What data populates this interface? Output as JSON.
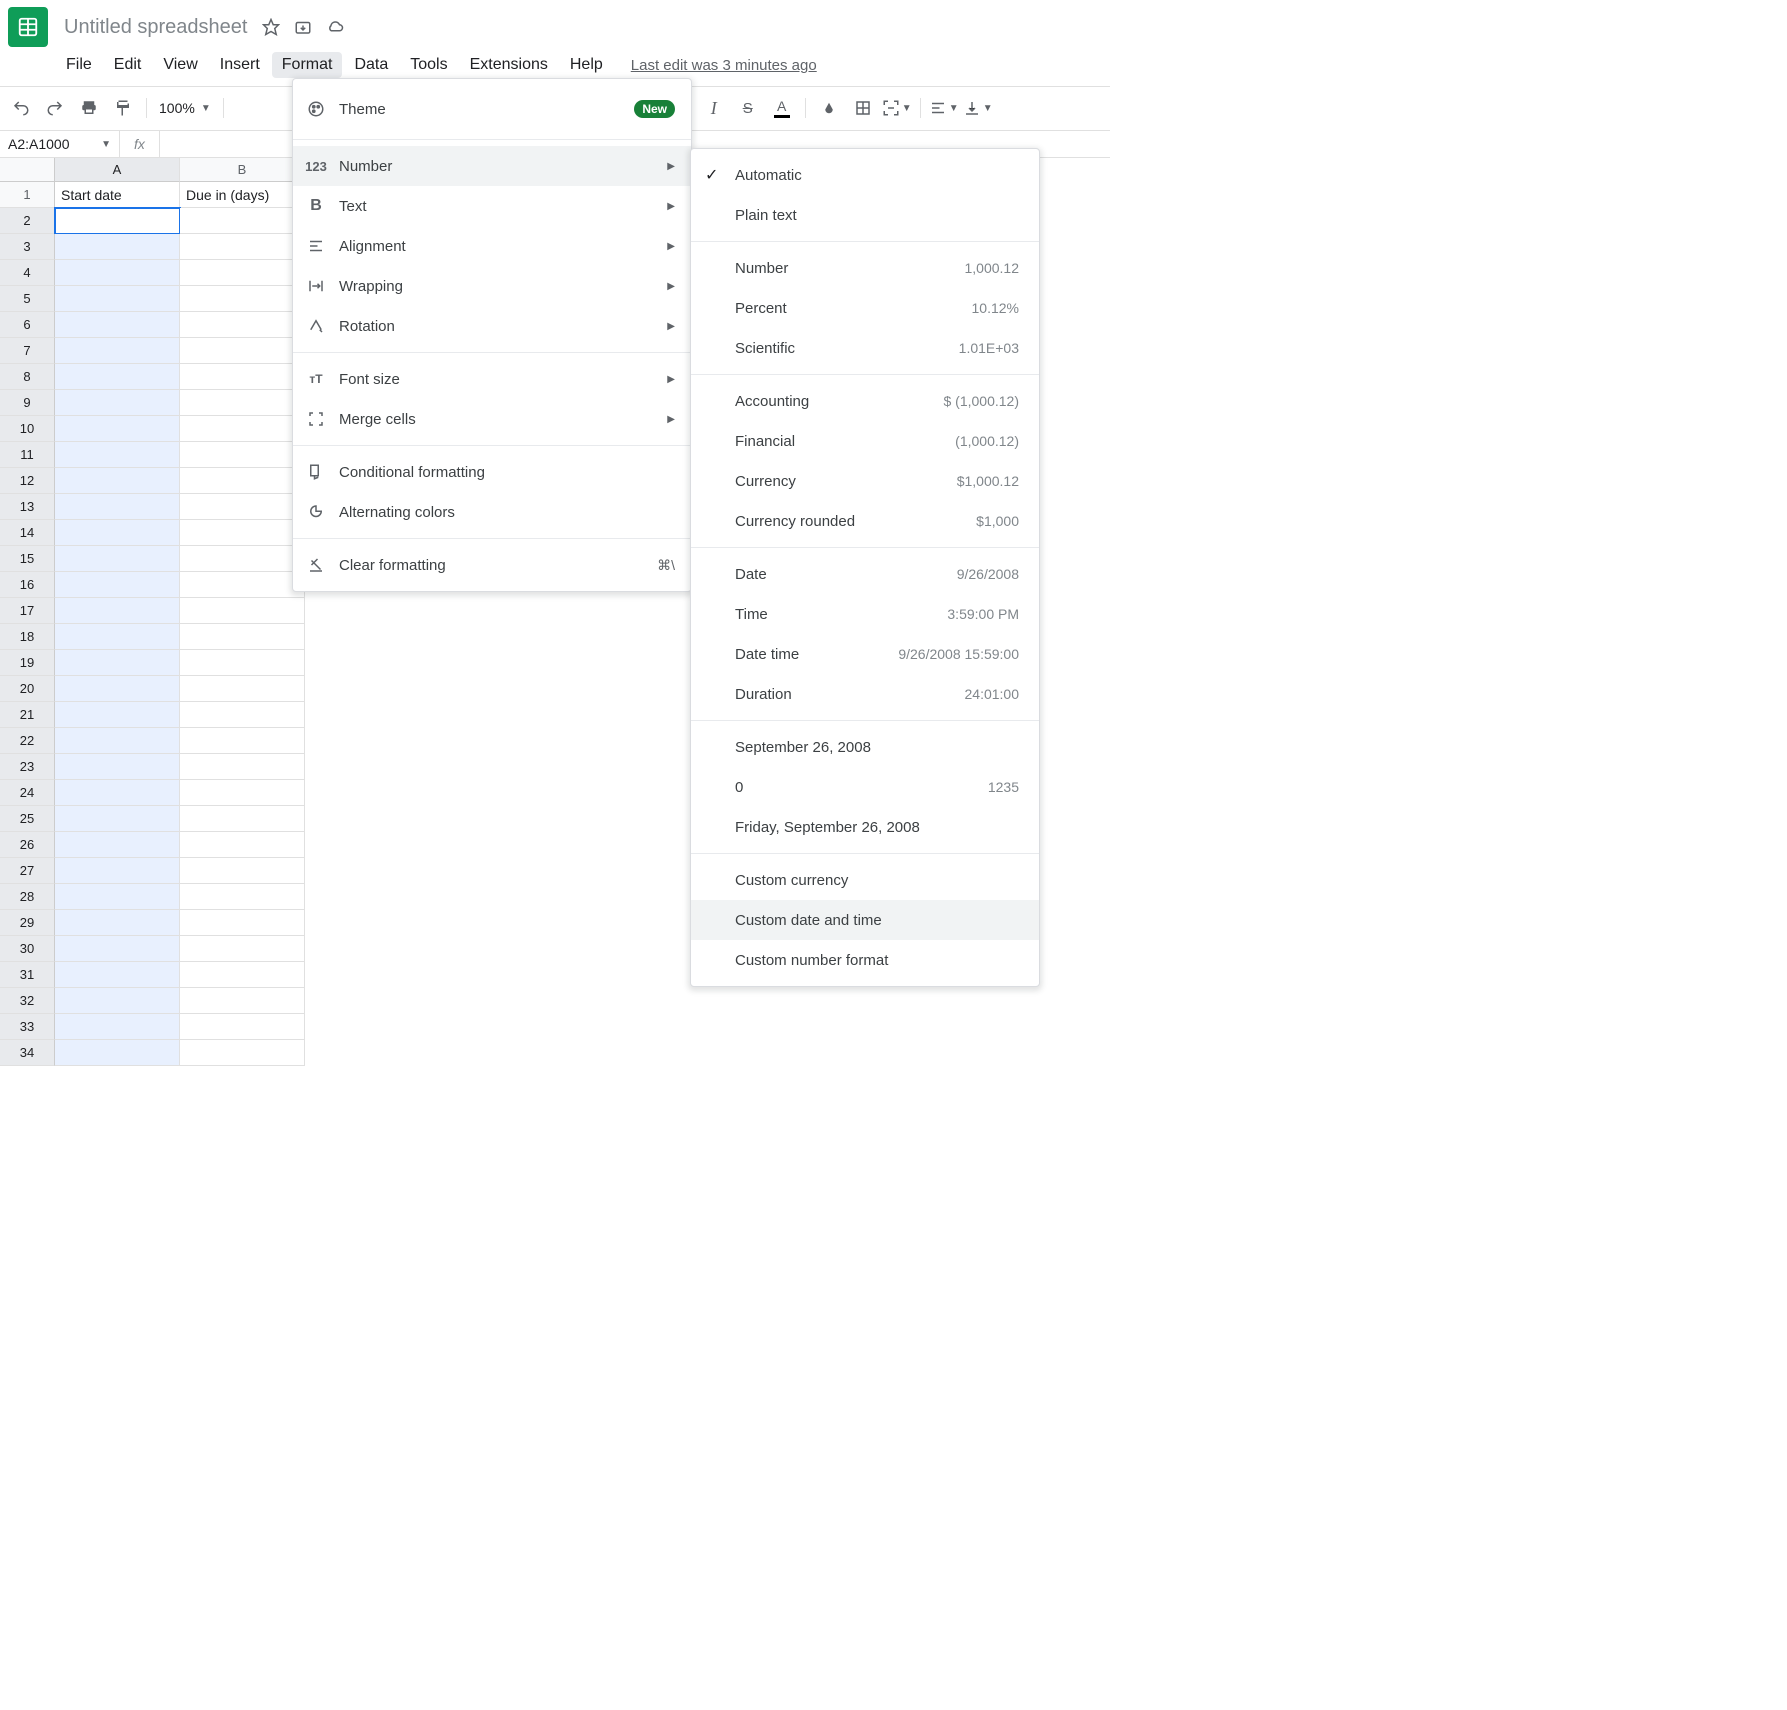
{
  "title": "Untitled spreadsheet",
  "menus": {
    "file": "File",
    "edit": "Edit",
    "view": "View",
    "insert": "Insert",
    "format": "Format",
    "data": "Data",
    "tools": "Tools",
    "extensions": "Extensions",
    "help": "Help"
  },
  "last_edit": "Last edit was 3 minutes ago",
  "zoom": "100%",
  "namebox": "A2:A1000",
  "fx_label": "fx",
  "columns": [
    "A",
    "B"
  ],
  "row_count": 34,
  "cells": {
    "A1": "Start date",
    "B1": "Due in (days)"
  },
  "format_menu": {
    "theme": "Theme",
    "theme_badge": "New",
    "number": "Number",
    "text": "Text",
    "alignment": "Alignment",
    "wrapping": "Wrapping",
    "rotation": "Rotation",
    "font_size": "Font size",
    "merge": "Merge cells",
    "conditional": "Conditional formatting",
    "alternating": "Alternating colors",
    "clear": "Clear formatting",
    "clear_key": "⌘\\"
  },
  "number_menu": {
    "automatic": "Automatic",
    "plain": "Plain text",
    "number": "Number",
    "number_ex": "1,000.12",
    "percent": "Percent",
    "percent_ex": "10.12%",
    "scientific": "Scientific",
    "scientific_ex": "1.01E+03",
    "accounting": "Accounting",
    "accounting_ex": "$ (1,000.12)",
    "financial": "Financial",
    "financial_ex": "(1,000.12)",
    "currency": "Currency",
    "currency_ex": "$1,000.12",
    "currency_rounded": "Currency rounded",
    "currency_rounded_ex": "$1,000",
    "date": "Date",
    "date_ex": "9/26/2008",
    "time": "Time",
    "time_ex": "3:59:00 PM",
    "datetime": "Date time",
    "datetime_ex": "9/26/2008 15:59:00",
    "duration": "Duration",
    "duration_ex": "24:01:00",
    "long1": "September 26, 2008",
    "long2_lbl": "0",
    "long2_ex": "1235",
    "long3": "Friday, September 26, 2008",
    "cust_currency": "Custom currency",
    "cust_datetime": "Custom date and time",
    "cust_number": "Custom number format"
  }
}
